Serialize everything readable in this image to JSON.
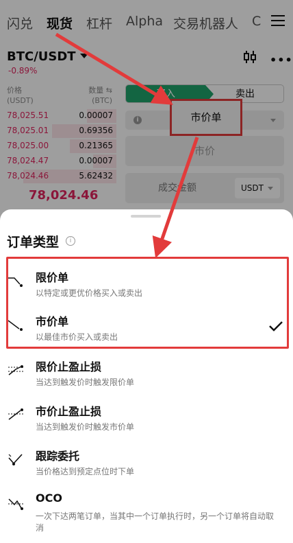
{
  "nav": {
    "tabs": [
      "闪兑",
      "现货",
      "杠杆",
      "Alpha",
      "交易机器人",
      "C"
    ],
    "active_index": 1
  },
  "market": {
    "pair": "BTC/USDT",
    "change": "-0.89%"
  },
  "orderbook": {
    "price_header": "价格\n(USDT)",
    "qty_header": "数量 ⇆\n(BTC)",
    "rows": [
      {
        "price": "78,025.51",
        "qty": "0.00007",
        "depth": 0.25
      },
      {
        "price": "78,025.01",
        "qty": "0.69356",
        "depth": 0.55
      },
      {
        "price": "78,025.00",
        "qty": "0.21365",
        "depth": 0.4
      },
      {
        "price": "78,024.47",
        "qty": "0.00007",
        "depth": 0.2
      },
      {
        "price": "78,024.46",
        "qty": "5.62432",
        "depth": 0.8
      }
    ],
    "last_price": "78,024.46"
  },
  "trade_form": {
    "buy_label": "买入",
    "sell_label": "卖出",
    "order_type_value": "市价单",
    "price_placeholder": "市价",
    "amount_label": "成交金额",
    "amount_unit": "USDT"
  },
  "sheet": {
    "title": "订单类型",
    "info_glyph": "i",
    "options": [
      {
        "title": "限价单",
        "desc": "以特定或更优价格买入或卖出",
        "selected": false
      },
      {
        "title": "市价单",
        "desc": "以最佳市价买入或卖出",
        "selected": true
      },
      {
        "title": "限价止盈止损",
        "desc": "当达到触发价时触发限价单",
        "selected": false
      },
      {
        "title": "市价止盈止损",
        "desc": "当达到触发价时触发市价单",
        "selected": false
      },
      {
        "title": "跟踪委托",
        "desc": "当价格达到预定点位时下单",
        "selected": false
      },
      {
        "title": "OCO",
        "desc": "一次下达两笔订单，当其中一个订单执行时，另一个订单将自动取消",
        "selected": false
      }
    ]
  },
  "colors": {
    "accent_green": "#1fa36b",
    "sell_red": "#e0245e",
    "annotation_red": "#e23b3b"
  }
}
